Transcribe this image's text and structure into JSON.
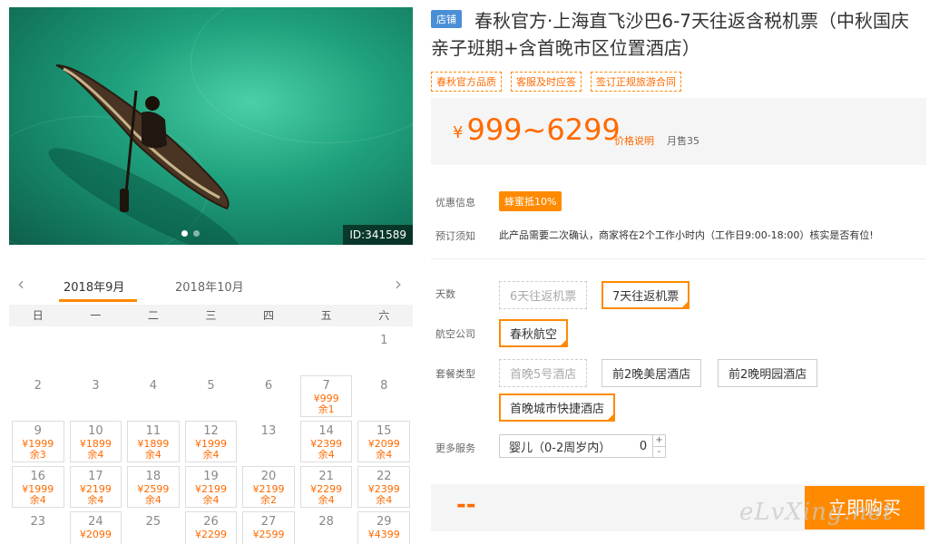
{
  "gallery": {
    "photo_id": "ID:341589",
    "dot_count": 2
  },
  "calendar": {
    "prev_icon": "chevron-left-icon",
    "next_icon": "chevron-right-icon",
    "months": [
      "2018年9月",
      "2018年10月"
    ],
    "active_month": 0,
    "weekdays": [
      "日",
      "一",
      "二",
      "三",
      "四",
      "五",
      "六"
    ],
    "leading_blanks": 6,
    "days": [
      {
        "d": "1"
      },
      {
        "d": "2"
      },
      {
        "d": "3"
      },
      {
        "d": "4"
      },
      {
        "d": "5"
      },
      {
        "d": "6"
      },
      {
        "d": "7",
        "price": "¥999",
        "left": "余1"
      },
      {
        "d": "8"
      },
      {
        "d": "9",
        "price": "¥1999",
        "left": "余3"
      },
      {
        "d": "10",
        "price": "¥1899",
        "left": "余4"
      },
      {
        "d": "11",
        "price": "¥1899",
        "left": "余4"
      },
      {
        "d": "12",
        "price": "¥1999",
        "left": "余4"
      },
      {
        "d": "13"
      },
      {
        "d": "14",
        "price": "¥2399",
        "left": "余4"
      },
      {
        "d": "15",
        "price": "¥2099",
        "left": "余4"
      },
      {
        "d": "16",
        "price": "¥1999",
        "left": "余4"
      },
      {
        "d": "17",
        "price": "¥2199",
        "left": "余4"
      },
      {
        "d": "18",
        "price": "¥2599",
        "left": "余4"
      },
      {
        "d": "19",
        "price": "¥2199",
        "left": "余4"
      },
      {
        "d": "20",
        "price": "¥2199",
        "left": "余2"
      },
      {
        "d": "21",
        "price": "¥2299",
        "left": "余4"
      },
      {
        "d": "22",
        "price": "¥2399",
        "left": "余4"
      },
      {
        "d": "23"
      },
      {
        "d": "24",
        "price": "¥2099",
        "left": ""
      },
      {
        "d": "25"
      },
      {
        "d": "26",
        "price": "¥2299",
        "left": ""
      },
      {
        "d": "27",
        "price": "¥2599",
        "left": ""
      },
      {
        "d": "28"
      },
      {
        "d": "29",
        "price": "¥4399",
        "left": ""
      }
    ]
  },
  "product": {
    "shop_tag": "店铺",
    "title": "春秋官方·上海直飞沙巴6-7天往返含税机票（中秋国庆亲子班期+含首晚市区位置酒店）",
    "badges": [
      "春秋官方品质",
      "客服及时应答",
      "签订正规旅游合同"
    ],
    "price_symbol": "¥",
    "price_range": "999~6299",
    "price_note": "价格说明",
    "sold": "月售35"
  },
  "info": {
    "discount_label": "优惠信息",
    "discount_tag": "蜂蜜抵10%",
    "notice_label": "预订须知",
    "notice_text": "此产品需要二次确认，商家将在2个工作小时内（工作日9:00-18:00）核实是否有位!"
  },
  "options": {
    "days_label": "天数",
    "days": [
      "6天往返机票",
      "7天往返机票"
    ],
    "airline_label": "航空公司",
    "airlines": [
      "春秋航空"
    ],
    "package_label": "套餐类型",
    "packages": [
      "首晚5号酒店",
      "前2晚美居酒店",
      "前2晚明园酒店",
      "首晚城市快捷酒店"
    ],
    "extra_label": "更多服务",
    "extra_item": "婴儿（0-2周岁内）",
    "extra_qty": "0",
    "plus": "+",
    "minus": "-"
  },
  "buy": {
    "total": "--",
    "button": "立即购买"
  },
  "watermark": "eLvXing.net",
  "colors": {
    "accent": "#ff8a00",
    "price": "#ff6a00",
    "shop_tag": "#4a8fd6"
  }
}
